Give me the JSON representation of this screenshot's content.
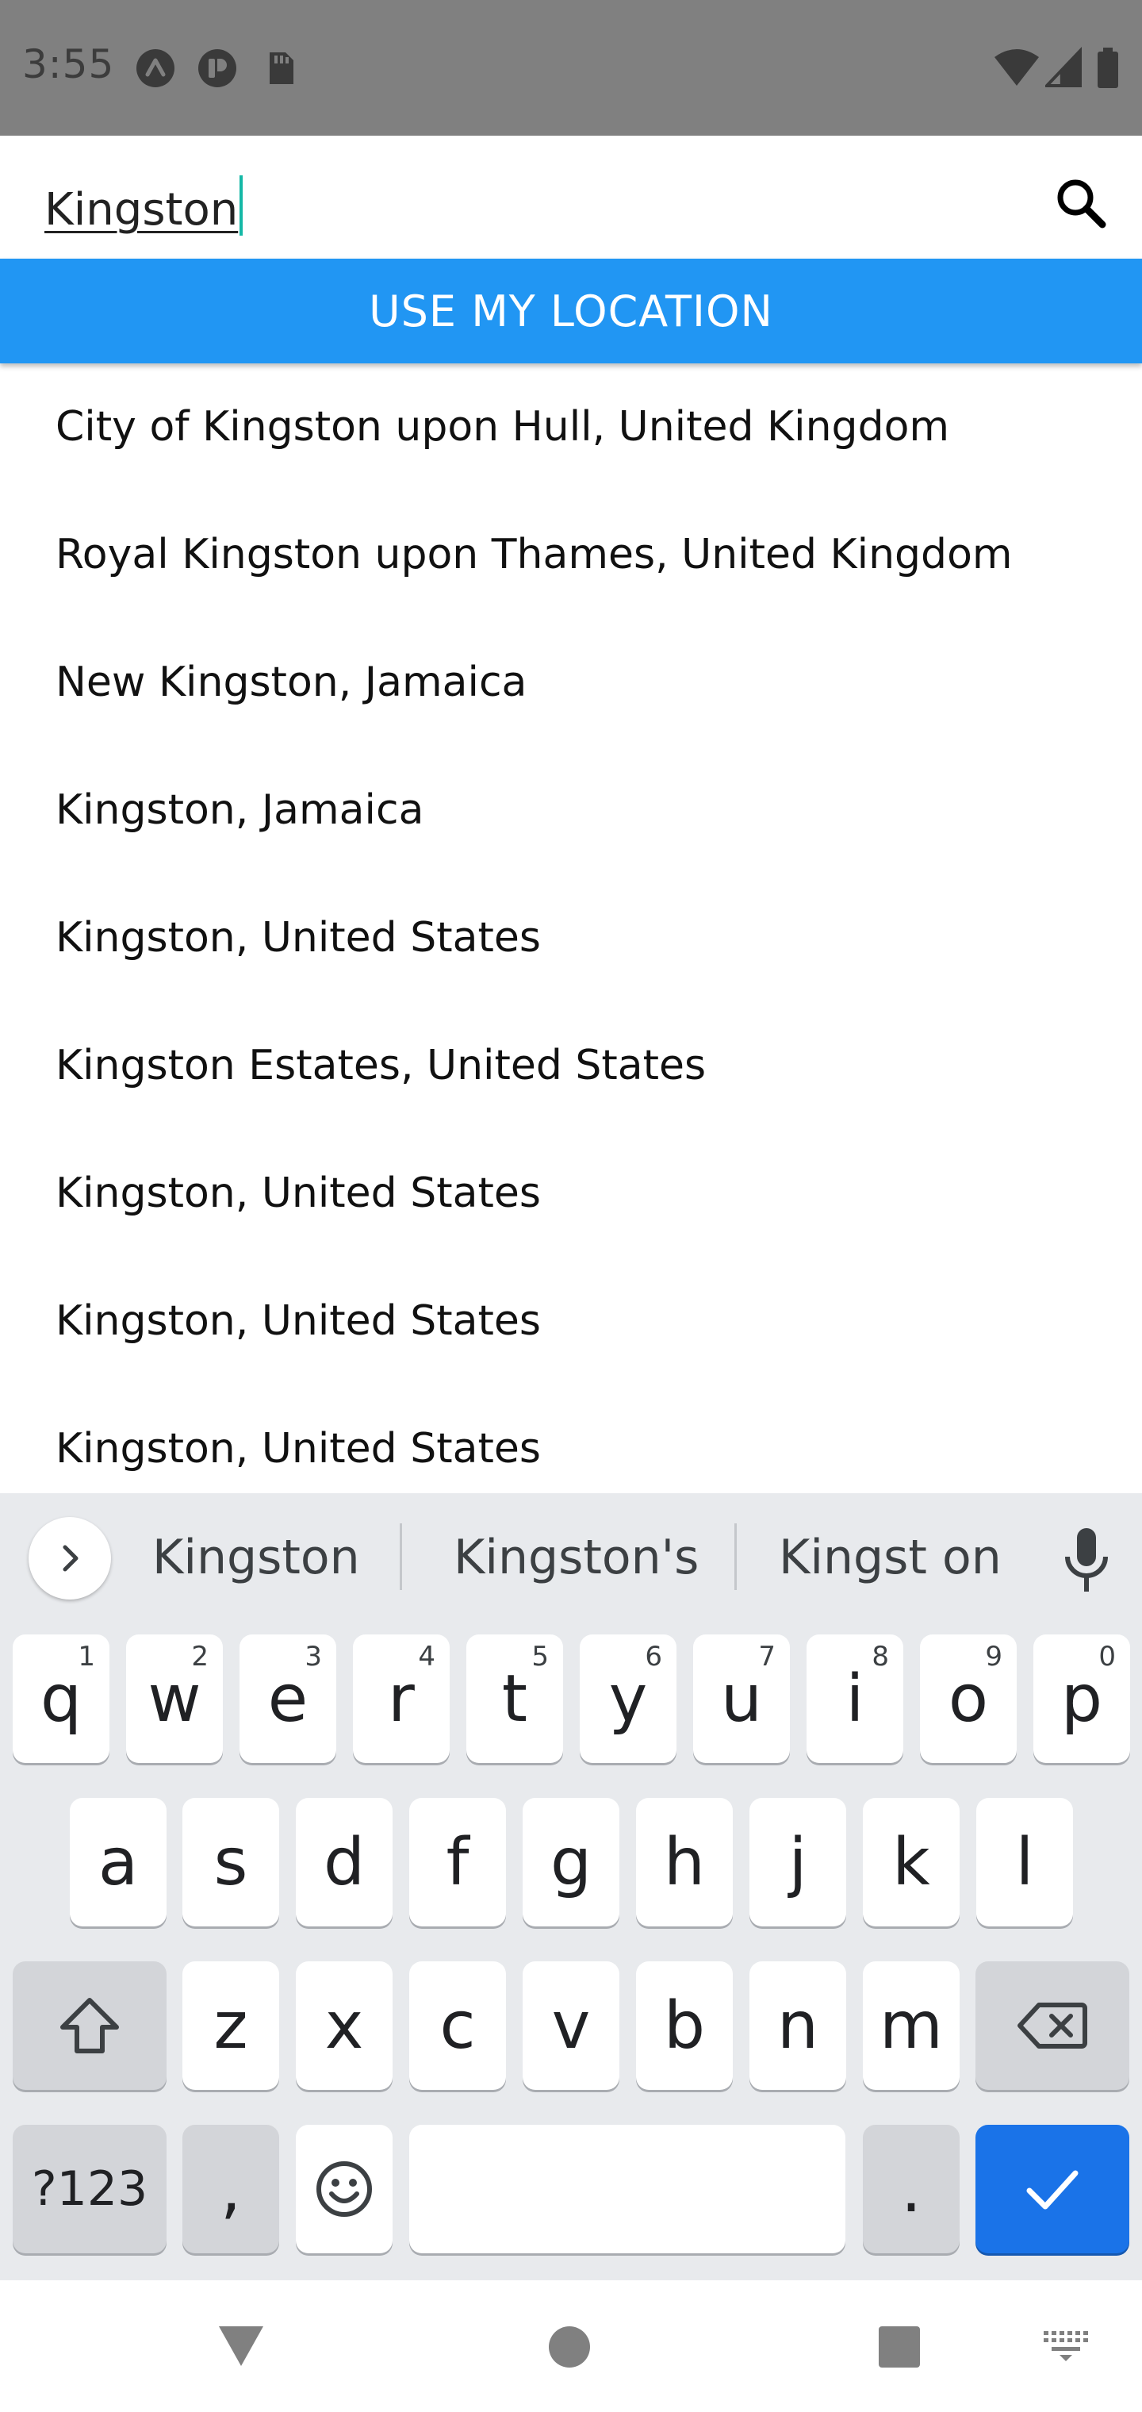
{
  "status_bar": {
    "time": "3:55",
    "left_icons": [
      "sync-circle-icon",
      "notification-circle-icon",
      "sd-card-icon"
    ],
    "right_icons": [
      "wifi-icon",
      "cell-signal-icon",
      "battery-icon"
    ]
  },
  "search": {
    "value": "Kingston",
    "icon": "search-icon"
  },
  "location_button": {
    "label": "USE MY LOCATION",
    "color": "#2196f3"
  },
  "results": [
    "City of Kingston upon Hull, United Kingdom",
    "Royal Kingston upon Thames, United Kingdom",
    "New Kingston, Jamaica",
    "Kingston, Jamaica",
    "Kingston, United States",
    "Kingston Estates, United States",
    "Kingston, United States",
    "Kingston, United States",
    "Kingston, United States"
  ],
  "keyboard": {
    "suggestions": [
      "Kingston",
      "Kingston's",
      "Kingst on"
    ],
    "row1": [
      {
        "key": "q",
        "hint": "1"
      },
      {
        "key": "w",
        "hint": "2"
      },
      {
        "key": "e",
        "hint": "3"
      },
      {
        "key": "r",
        "hint": "4"
      },
      {
        "key": "t",
        "hint": "5"
      },
      {
        "key": "y",
        "hint": "6"
      },
      {
        "key": "u",
        "hint": "7"
      },
      {
        "key": "i",
        "hint": "8"
      },
      {
        "key": "o",
        "hint": "9"
      },
      {
        "key": "p",
        "hint": "0"
      }
    ],
    "row2": [
      "a",
      "s",
      "d",
      "f",
      "g",
      "h",
      "j",
      "k",
      "l"
    ],
    "row3": [
      "z",
      "x",
      "c",
      "v",
      "b",
      "n",
      "m"
    ],
    "symbols_label": "?123",
    "comma_label": ",",
    "period_label": ".",
    "accent_color": "#1a73e8"
  },
  "nav_bar": {
    "icons": [
      "back-triangle-icon",
      "home-circle-icon",
      "recents-square-icon",
      "keyboard-switch-icon"
    ]
  }
}
